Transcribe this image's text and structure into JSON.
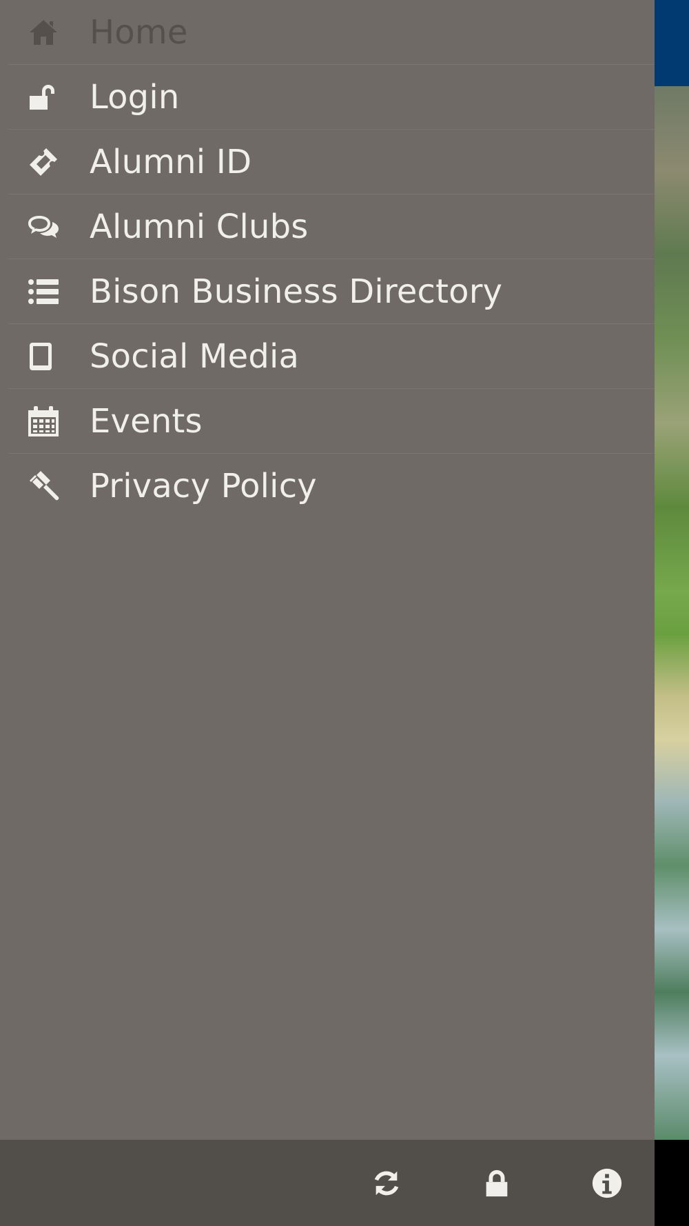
{
  "menu": {
    "items": [
      {
        "label": "Home",
        "icon": "home-icon",
        "active": true
      },
      {
        "label": "Login",
        "icon": "unlock-icon"
      },
      {
        "label": "Alumni ID",
        "icon": "ticket-icon"
      },
      {
        "label": "Alumni Clubs",
        "icon": "chat-bubbles-icon"
      },
      {
        "label": "Bison Business Directory",
        "icon": "list-icon"
      },
      {
        "label": "Social Media",
        "icon": "tablet-icon"
      },
      {
        "label": "Events",
        "icon": "calendar-icon"
      },
      {
        "label": "Privacy Policy",
        "icon": "gavel-icon"
      }
    ]
  },
  "bottom_bar": {
    "buttons": [
      {
        "icon": "refresh-icon"
      },
      {
        "icon": "lock-icon"
      },
      {
        "icon": "info-icon"
      }
    ]
  },
  "colors": {
    "drawer_bg": "#6f6a65",
    "bottom_bar_bg": "#524e4a",
    "text": "#f1efeb",
    "active_text": "#55504c",
    "app_header": "#003a70"
  }
}
